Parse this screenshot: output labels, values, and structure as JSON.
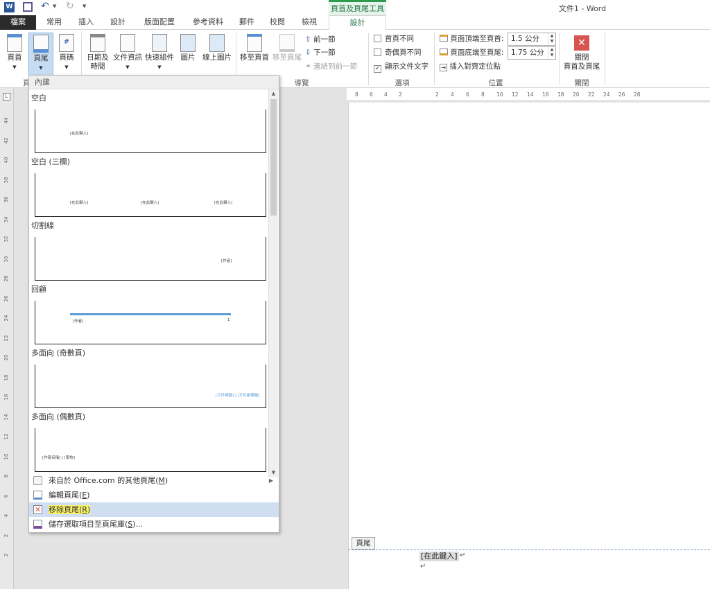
{
  "title_bar": {
    "context_group": "頁首及頁尾工具",
    "doc_title": "文件1 - Word"
  },
  "tabs": {
    "file": "檔案",
    "home": "常用",
    "insert": "插入",
    "design_doc": "設計",
    "layout": "版面配置",
    "references": "參考資料",
    "mailings": "郵件",
    "review": "校閱",
    "view": "檢視",
    "design": "設計"
  },
  "ribbon": {
    "header_btn": "頁首",
    "footer_btn": "頁尾",
    "page_number_btn": "頁碼",
    "header_footer_group_fragment": "頁",
    "date_time_btn": [
      "日期及",
      "時間"
    ],
    "doc_info_btn": "文件資訊",
    "quick_parts_btn": "快速組件",
    "pictures_btn": "圖片",
    "online_pictures_btn": "線上圖片",
    "goto_header_btn": "移至頁首",
    "goto_footer_btn": "移至頁尾",
    "prev_btn": "前一節",
    "next_btn": "下一節",
    "link_prev_btn": "連結到前一節",
    "nav_group": "導覽",
    "different_first": "首頁不同",
    "different_odd_even": "奇偶頁不同",
    "show_doc_text": "顯示文件文字",
    "options_group": "選項",
    "header_from_top_label": "頁面頂端至頁首:",
    "header_from_top_value": "1.5 公分",
    "footer_from_bottom_label": "頁面底端至頁尾:",
    "footer_from_bottom_value": "1.75 公分",
    "insert_align_tab": "插入對齊定位點",
    "position_group": "位置",
    "close_btn": [
      "關閉",
      "頁首及頁尾"
    ],
    "close_group": "關閉"
  },
  "dropdown": {
    "header": "內建",
    "gallery": [
      {
        "name": "空白",
        "placeholders": [
          "[在此鍵入]"
        ]
      },
      {
        "name": "空白 (三欄)",
        "placeholders": [
          "[在此鍵入]",
          "[在此鍵入]",
          "[在此鍵入]"
        ]
      },
      {
        "name": "切割線",
        "placeholders": [
          "[作者]"
        ]
      },
      {
        "name": "回顧",
        "placeholders": [
          "[作者]",
          "1"
        ]
      },
      {
        "name": "多面向 (奇數頁)",
        "placeholders": [
          "[文件標題] | [文件副標題]"
        ]
      },
      {
        "name": "多面向 (偶數頁)",
        "placeholders": [
          "[作者名稱] | [學校]"
        ]
      }
    ],
    "menu": [
      {
        "label": "來自於 Office.com 的其他頁尾(",
        "key": "M",
        "suffix": ")"
      },
      {
        "label": "編輯頁尾(",
        "key": "E",
        "suffix": ")"
      },
      {
        "label": "移除頁尾(",
        "key": "R",
        "suffix": ")"
      },
      {
        "label": "儲存選取項目至頁尾庫(",
        "key": "S",
        "suffix": ")..."
      }
    ]
  },
  "ruler": {
    "horizontal": [
      "8",
      "6",
      "4",
      "2",
      "2",
      "4",
      "6",
      "8",
      "10",
      "12",
      "14",
      "16",
      "18",
      "20",
      "22",
      "24",
      "26",
      "28"
    ],
    "vertical": [
      "44",
      "42",
      "40",
      "38",
      "36",
      "34",
      "32",
      "30",
      "28",
      "26",
      "24",
      "22",
      "20",
      "18",
      "16",
      "14",
      "12",
      "10",
      "8",
      "6",
      "4",
      "2",
      "2"
    ]
  },
  "document": {
    "footer_tag": "頁尾",
    "footer_placeholder": "[在此鍵入]"
  },
  "colors": {
    "accent_green": "#217346",
    "file_tab_bg": "#2b2b2b",
    "highlight": "#fbf46a",
    "hover_row": "#cfdff1",
    "close_red": "#d9534f"
  }
}
